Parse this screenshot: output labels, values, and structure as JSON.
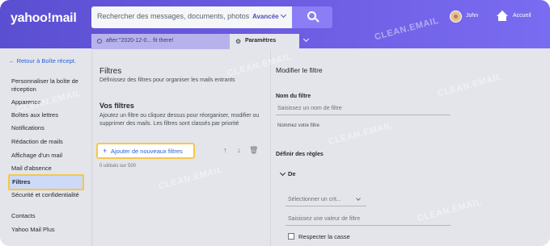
{
  "header": {
    "logo": "yahoo!mail",
    "search_placeholder": "Rechercher des messages, documents, photos",
    "advanced_label": "Avancée",
    "user_name": "John",
    "home_label": "Accueil"
  },
  "tabs": {
    "search_tab_text": "after:\"2020-12-0... fit there!",
    "settings_tab_label": "Paramètres"
  },
  "sidebar": {
    "back_label": "← Retour à Boîte récept.",
    "items": [
      {
        "label": "Personnaliser la boîte de réception"
      },
      {
        "label": "Apparence"
      },
      {
        "label": "Boîtes aux lettres"
      },
      {
        "label": "Notifications"
      },
      {
        "label": "Rédaction de mails"
      },
      {
        "label": "Affichage d'un mail"
      },
      {
        "label": "Mail d'absence"
      },
      {
        "label": "Filtres"
      },
      {
        "label": "Sécurité et confidentialité"
      },
      {
        "label": "Contacts"
      },
      {
        "label": "Yahoo Mail Plus"
      }
    ],
    "active_item": "Filtres"
  },
  "filters_panel": {
    "title": "Filtres",
    "subtitle": "Définissez des filtres pour organiser les mails entrants",
    "section_title": "Vos filtres",
    "section_desc": "Ajoutez un filtre ou cliquez dessus pour réorganiser, modifier ou supprimer des mails. Les filtres sont classés par priorité",
    "add_button": "Ajouter de nouveaux filtres",
    "usage": "0 utilisés sur 500"
  },
  "edit_panel": {
    "title": "Modifier le filtre",
    "name_label": "Nom du filtre",
    "name_placeholder": "Saisissez un nom de filtre",
    "name_hint": "Nommez votre filtre",
    "rules_label": "Définir des règles",
    "from_label": "De",
    "criterion_placeholder": "Sélectionner un crit...",
    "value_placeholder": "Saisissez une valeur de filtre",
    "match_case_label": "Respecter la casse"
  },
  "watermark": "CLEAN.EMAIL"
}
